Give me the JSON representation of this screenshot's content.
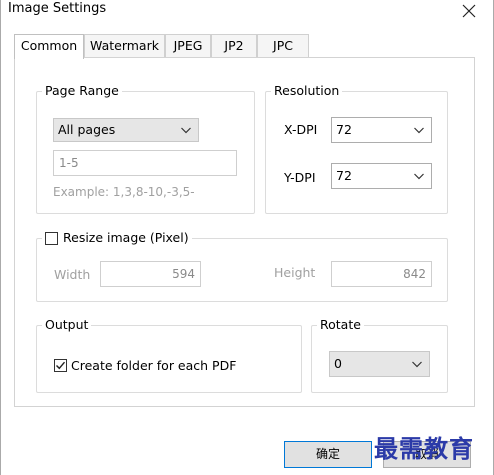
{
  "window": {
    "title": "Image Settings"
  },
  "tabs": [
    {
      "label": "Common",
      "active": true
    },
    {
      "label": "Watermark",
      "active": false
    },
    {
      "label": "JPEG",
      "active": false
    },
    {
      "label": "JP2",
      "active": false
    },
    {
      "label": "JPC",
      "active": false
    }
  ],
  "page_range": {
    "label": "Page Range",
    "mode": "All pages",
    "pages_value": "1-5",
    "example": "Example: 1,3,8-10,-3,5-"
  },
  "resolution": {
    "label": "Resolution",
    "xdpi_label": "X-DPI",
    "xdpi_value": "72",
    "ydpi_label": "Y-DPI",
    "ydpi_value": "72"
  },
  "resize": {
    "label": "Resize image (Pixel)",
    "checked": false,
    "width_label": "Width",
    "width_value": "594",
    "height_label": "Height",
    "height_value": "842"
  },
  "output": {
    "label": "Output",
    "create_folder_label": "Create folder for each PDF",
    "create_folder_checked": true
  },
  "rotate": {
    "label": "Rotate",
    "value": "0"
  },
  "buttons": {
    "ok": "确定",
    "cancel": "取消"
  },
  "watermark_text": "最需教育",
  "colors": {
    "accent_border": "#0078d7",
    "watermark": "#2b3aa8"
  }
}
